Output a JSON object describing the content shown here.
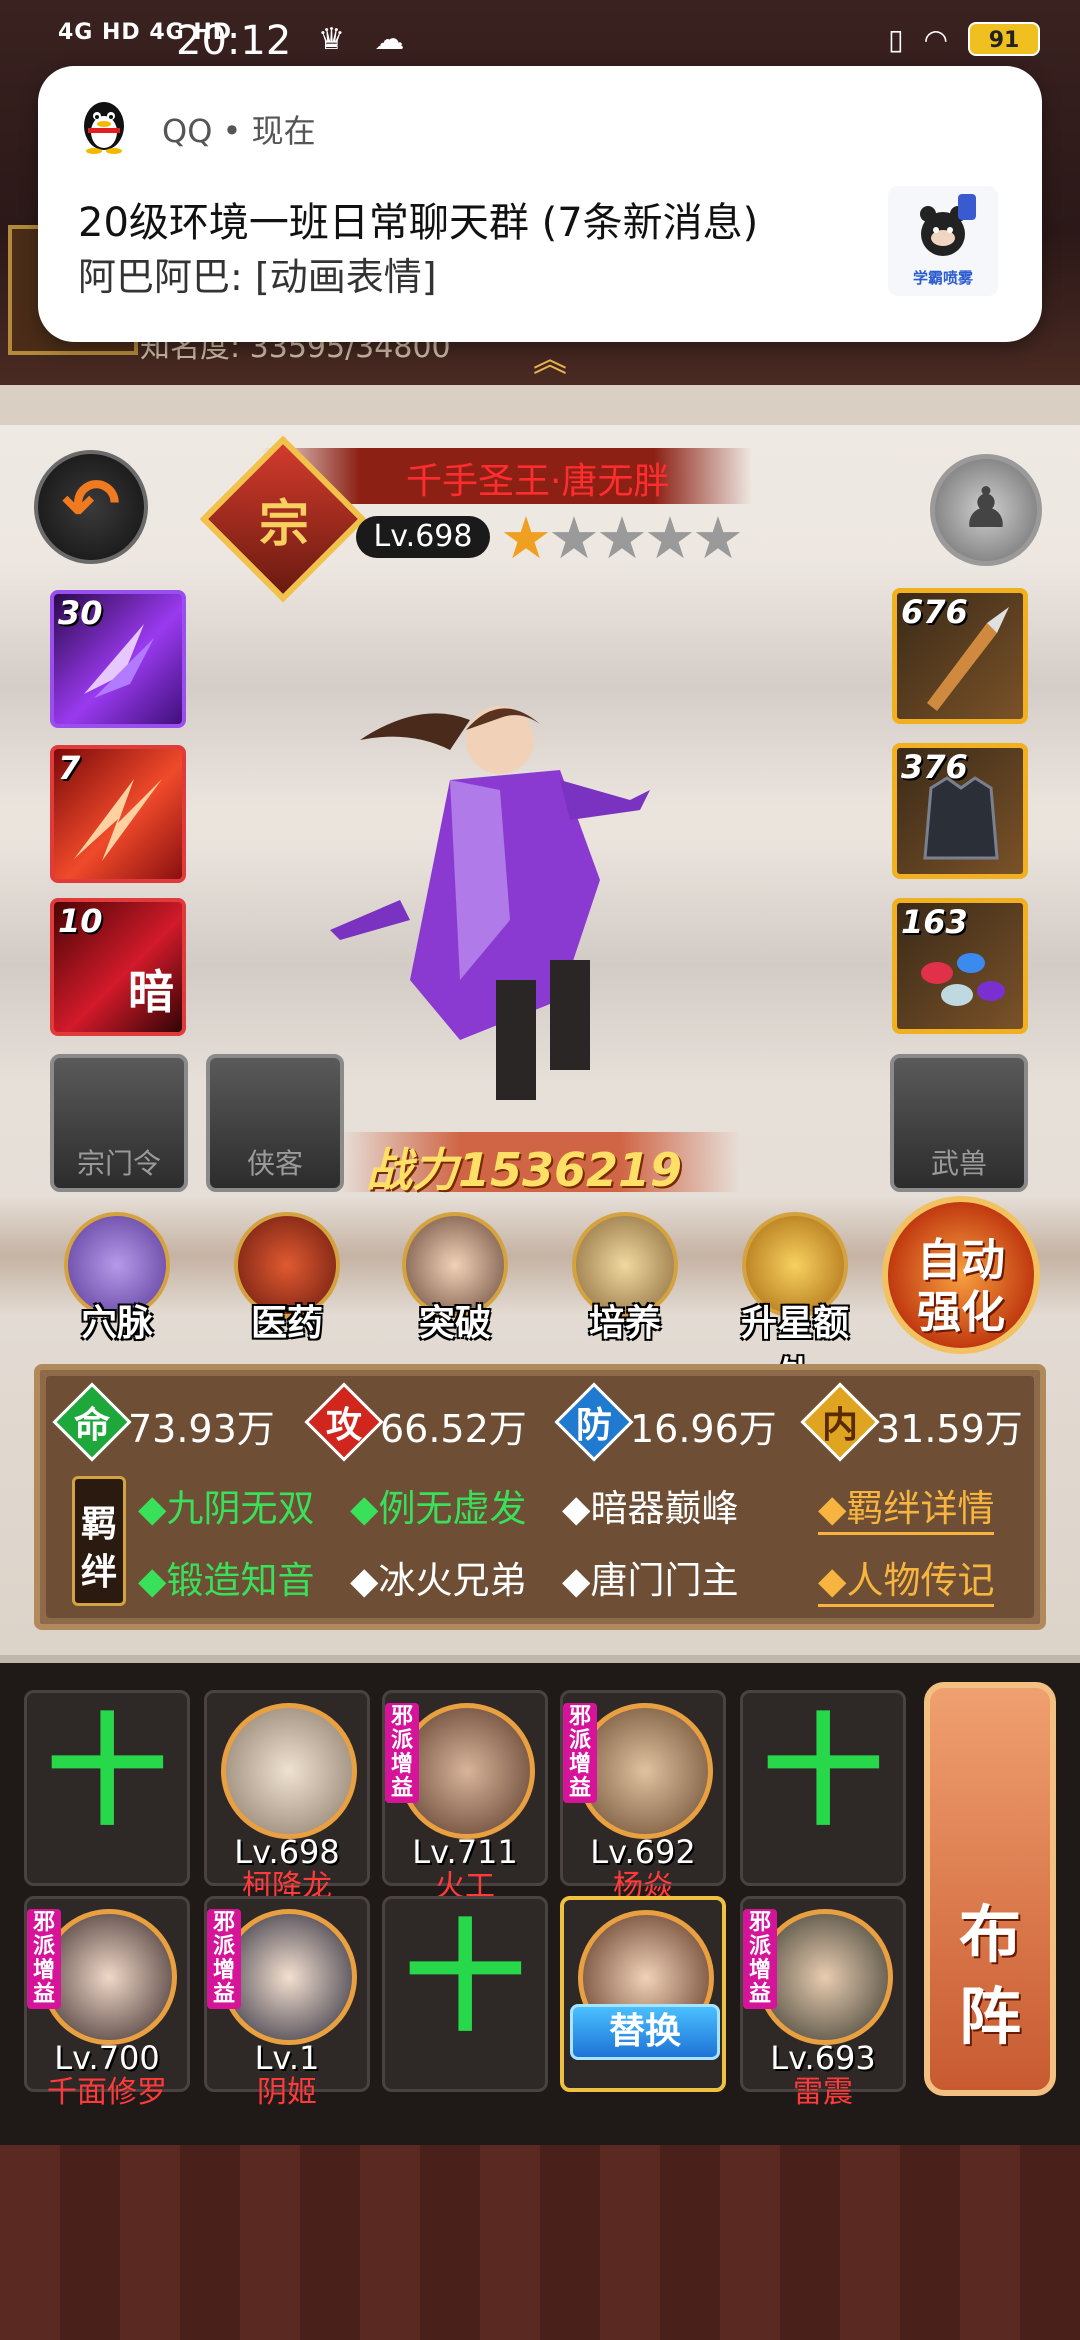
{
  "status_bar": {
    "signal": "4G HD 4G HD",
    "time": "20:12",
    "battery": "91"
  },
  "notification": {
    "app": "QQ • 现在",
    "title": "20级环境一班日常聊天群 (7条新消息)",
    "message": "阿巴阿巴: [动画表情]",
    "thumb_label": "学霸喷雾"
  },
  "game_header": {
    "fame": "知名度: 33595/34800"
  },
  "hero": {
    "name": "千手圣王·唐无胖",
    "rank": "宗",
    "level": "Lv.698",
    "stars_total": 5,
    "stars_filled": 1,
    "power": "战力1536219"
  },
  "skills": [
    {
      "level": "30",
      "glyph": ""
    },
    {
      "level": "7",
      "glyph": ""
    },
    {
      "level": "10",
      "glyph": "暗"
    }
  ],
  "equipment": [
    {
      "level": "676",
      "icon": "dagger-icon"
    },
    {
      "level": "376",
      "icon": "armor-icon"
    },
    {
      "level": "163",
      "icon": "gems-icon"
    }
  ],
  "empty_slots": {
    "sect_token": "宗门令",
    "companion": "侠客",
    "beast": "武兽"
  },
  "functions": [
    {
      "label": "穴脉",
      "icon": "meridian-icon"
    },
    {
      "label": "医药",
      "icon": "medicine-icon"
    },
    {
      "label": "突破",
      "icon": "breakthrough-icon"
    },
    {
      "label": "培养",
      "icon": "scroll-icon"
    },
    {
      "label": "升星额外",
      "icon": "treasure-icon"
    }
  ],
  "auto_enhance": {
    "line1": "自动",
    "line2": "强化"
  },
  "stats": [
    {
      "char": "命",
      "value": "73.93万",
      "color": "#1ea83c"
    },
    {
      "char": "攻",
      "value": "66.52万",
      "color": "#d0261e"
    },
    {
      "char": "防",
      "value": "16.96万",
      "color": "#1f7ad0"
    },
    {
      "char": "内",
      "value": "31.59万",
      "color": "#e0a520"
    }
  ],
  "bonds": {
    "tag1": "羁",
    "tag2": "绊",
    "row1": [
      "◆九阴无双",
      "◆例无虚发",
      "◆暗器巅峰"
    ],
    "row2": [
      "◆锻造知音",
      "◆冰火兄弟",
      "◆唐门门主"
    ],
    "detail_link": "◆羁绊详情",
    "biography_link": "◆人物传记"
  },
  "team": {
    "row1": [
      {
        "empty": true
      },
      {
        "level": "Lv.698",
        "name": "柯降龙",
        "tag": ""
      },
      {
        "level": "Lv.711",
        "name": "火工",
        "tag": "邪派增益"
      },
      {
        "level": "Lv.692",
        "name": "杨焱",
        "tag": "邪派增益"
      },
      {
        "empty": true
      }
    ],
    "row2": [
      {
        "level": "Lv.700",
        "name": "千面修罗",
        "tag": "邪派增益"
      },
      {
        "level": "Lv.1",
        "name": "阴姬",
        "tag": "邪派增益"
      },
      {
        "empty": true
      },
      {
        "swap": "替换"
      },
      {
        "level": "Lv.693",
        "name": "雷震",
        "tag": "邪派增益"
      }
    ],
    "plus": "十",
    "lineup1": "布",
    "lineup2": "阵"
  }
}
